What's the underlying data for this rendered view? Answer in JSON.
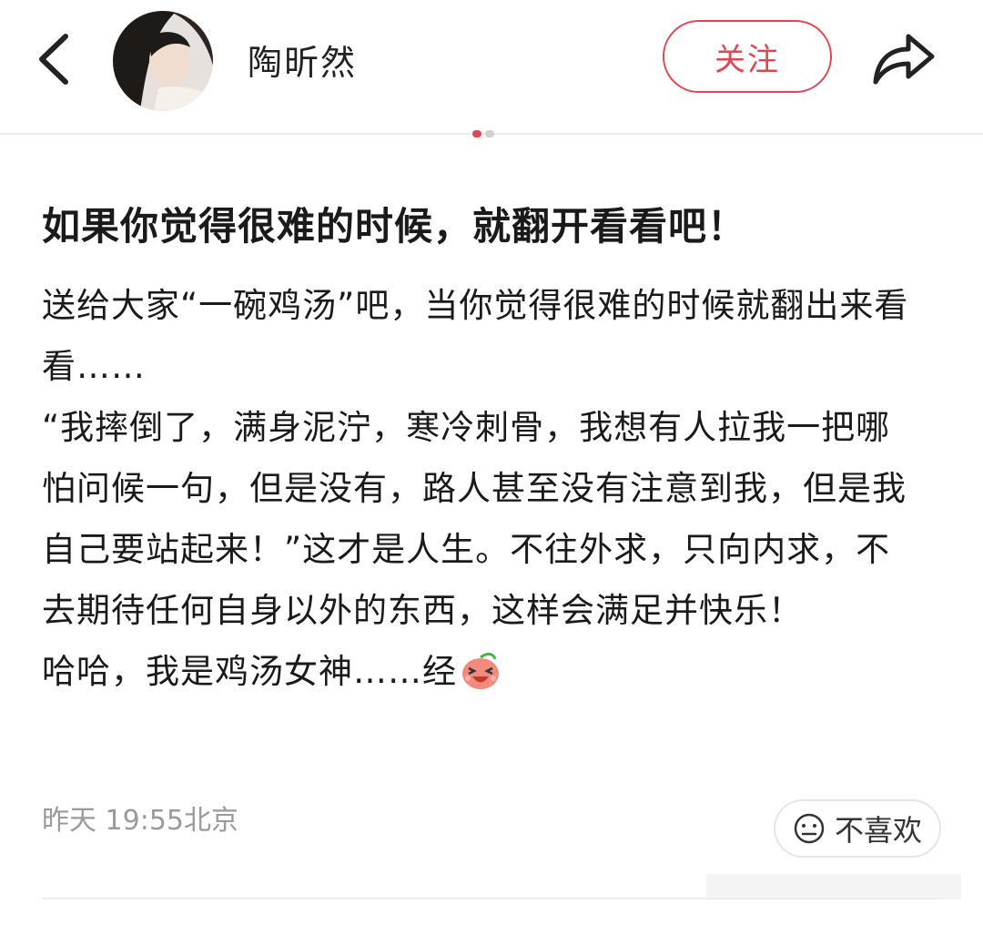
{
  "header": {
    "author_name": "陶昕然",
    "follow_label": "关注",
    "back_icon": "chevron-left-icon",
    "share_icon": "share-arrow-icon",
    "avatar": "author-avatar"
  },
  "colors": {
    "accent": "#e4454f",
    "text": "#1a1a1a",
    "muted": "#9a9a9a"
  },
  "post": {
    "title": "如果你觉得很难的时候，就翻开看看吧！",
    "paragraphs": [
      "送给大家“一碗鸡汤”吧，当你觉得很难的时候就翻出来看看……",
      "“我摔倒了，满身泥泞，寒冷刺骨，我想有人拉我一把哪怕问候一句，但是没有，路人甚至没有注意到我，但是我自己要站起来！”这才是人生。不往外求，只向内求，不去期待任何自身以外的东西，这样会满足并快乐！",
      "哈哈，我是鸡汤女神……经"
    ],
    "emoji": "laughing-face-emoji",
    "timestamp": "昨天 19:55北京",
    "dislike_label": "不喜欢",
    "dislike_icon": "neutral-face-icon"
  }
}
